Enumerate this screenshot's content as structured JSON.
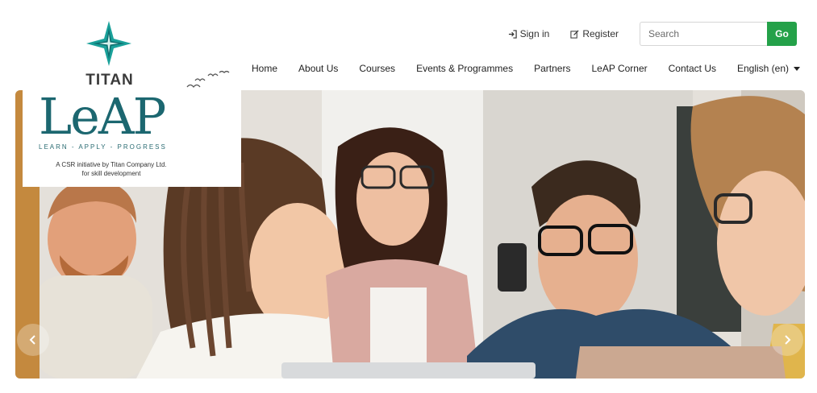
{
  "topbar": {
    "sign_in": "Sign in",
    "register": "Register",
    "search_placeholder": "Search",
    "go_label": "Go"
  },
  "nav": {
    "items": [
      "Home",
      "About Us",
      "Courses",
      "Events & Programmes",
      "Partners",
      "LeAP Corner",
      "Contact Us"
    ],
    "language": "English (en)"
  },
  "logo": {
    "brand": "TITAN",
    "product": "LeAP",
    "tagline": "LEARN - APPLY - PROGRESS",
    "csr_line1": "A CSR initiative by Titan Company Ltd.",
    "csr_line2": "for skill development"
  },
  "colors": {
    "accent_green": "#24a149",
    "brand_teal": "#1c6770"
  },
  "icons": {
    "sign_in": "sign-in-icon",
    "register": "edit-icon",
    "language": "chevron-down-icon",
    "prev": "chevron-left-icon",
    "next": "chevron-right-icon"
  }
}
